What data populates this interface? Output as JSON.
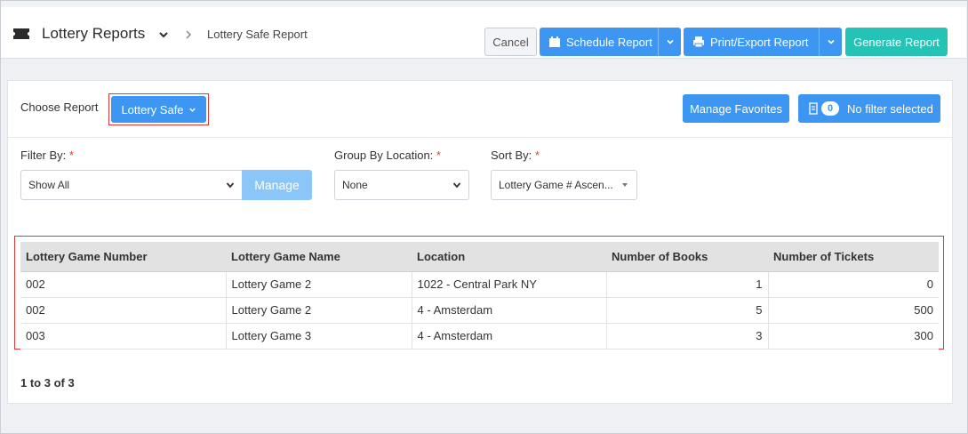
{
  "header": {
    "app_title": "Lottery Reports",
    "breadcrumb": "Lottery Safe Report",
    "cancel_label": "Cancel",
    "schedule_label": "Schedule Report",
    "print_label": "Print/Export Report",
    "generate_label": "Generate Report"
  },
  "report": {
    "choose_label": "Choose Report",
    "selected": "Lottery Safe",
    "favorites_label": "Manage Favorites",
    "filter_count": "0",
    "filter_text": "No filter selected"
  },
  "filters": {
    "filter_by_label": "Filter By:",
    "filter_by_value": "Show All",
    "manage_label": "Manage",
    "group_label": "Group By Location:",
    "group_value": "None",
    "sort_label": "Sort By:",
    "sort_value": "Lottery Game # Ascen...",
    "required_mark": "*"
  },
  "table": {
    "columns": [
      "Lottery Game Number",
      "Lottery Game Name",
      "Location",
      "Number of Books",
      "Number of Tickets"
    ],
    "rows": [
      [
        "002",
        "Lottery Game 2",
        "1022 - Central Park NY",
        "1",
        "0"
      ],
      [
        "002",
        "Lottery Game 2",
        "4 - Amsterdam",
        "5",
        "500"
      ],
      [
        "003",
        "Lottery Game 3",
        "4 - Amsterdam",
        "3",
        "300"
      ]
    ]
  },
  "pager": {
    "text": "1 to 3 of 3"
  },
  "colors": {
    "primary": "#3d97f2",
    "teal": "#24c3b5",
    "highlight": "#e0393b",
    "manage_disabled": "#8cc5f7"
  }
}
